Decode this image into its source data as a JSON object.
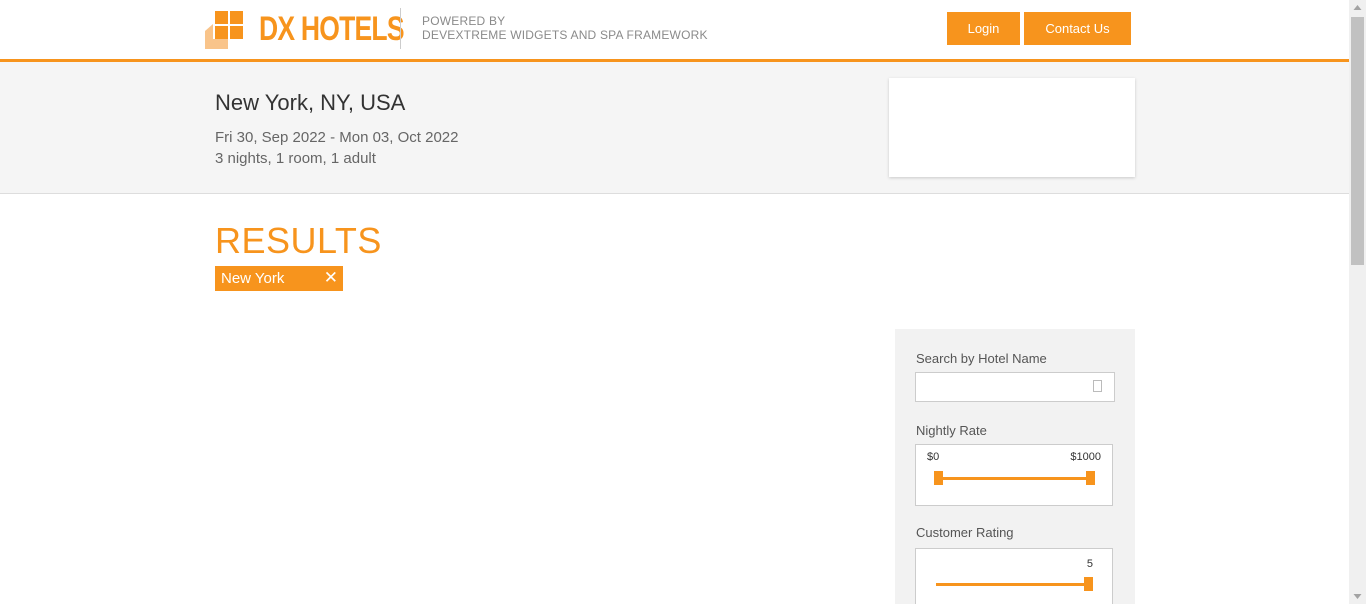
{
  "header": {
    "logo_text": "DX HOTELS",
    "powered_line1": "POWERED BY",
    "powered_line2": "DEVEXTREME WIDGETS AND SPA FRAMEWORK",
    "login_label": "Login",
    "contact_label": "Contact Us"
  },
  "search_summary": {
    "city": "New York, NY, USA",
    "dates": "Fri 30, Sep 2022 - Mon 03, Oct 2022",
    "details": "3 nights, 1 room, 1 adult"
  },
  "results": {
    "title": "RESULTS",
    "tag_label": "New York",
    "tag_close": "✕"
  },
  "filters": {
    "search_label": "Search by Hotel Name",
    "search_value": "",
    "nightly_rate_label": "Nightly Rate",
    "nightly_rate_min": "$0",
    "nightly_rate_max": "$1000",
    "customer_rating_label": "Customer Rating",
    "customer_rating_value": "5"
  },
  "colors": {
    "accent": "#f7941d",
    "band_bg": "#f5f5f5"
  },
  "icons": [
    "logo-icon",
    "close-icon",
    "search-icon",
    "scroll-up-arrow-icon",
    "scroll-down-arrow-icon"
  ]
}
